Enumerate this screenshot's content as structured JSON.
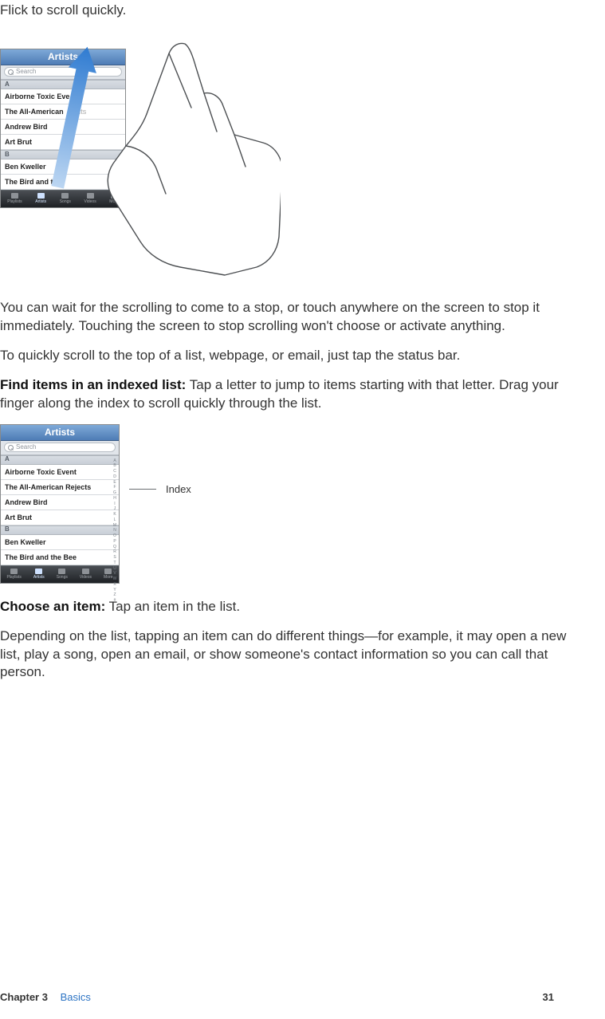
{
  "intro": "Flick to scroll quickly.",
  "para_after_fig1": "You can wait for the scrolling to come to a stop, or touch anywhere on the screen to stop it immediately. Touching the screen to stop scrolling won't choose or activate anything.",
  "para_scroll_top": "To quickly scroll to the top of a list, webpage, or email, just tap the status bar.",
  "find_label": "Find items in an indexed list:",
  "find_body": "Tap a letter to jump to items starting with that letter. Drag your finger along the index to scroll quickly through the list.",
  "index_callout": "Index",
  "choose_label": "Choose an item:",
  "choose_body": "Tap an item in the list.",
  "para_depending": "Depending on the list, tapping an item can do different things—for example, it may open a new list, play a song, open an email, or show someone's contact information so you can call that person.",
  "footer": {
    "chapter": "Chapter 3",
    "title": "Basics",
    "page": "31"
  },
  "ipod": {
    "title": "Artists",
    "search_placeholder": "Search",
    "section_a": "A",
    "section_b": "B",
    "rows_a": [
      "Airborne Toxic Event",
      "The All-American Rejects",
      "Andrew Bird",
      "Art Brut"
    ],
    "rows_b": [
      "Ben Kweller",
      "The Bird and the Bee"
    ],
    "rows_a_trunc": [
      "Airborne Toxic Eve",
      "The All-American",
      "Andrew Bird",
      "Art Brut"
    ],
    "rows_b_trunc": [
      "Ben Kweller",
      "The Bird and the"
    ],
    "tabs": [
      "Playlists",
      "Artists",
      "Songs",
      "Videos",
      "More"
    ],
    "index_letters": [
      "A",
      "B",
      "C",
      "D",
      "E",
      "F",
      "G",
      "H",
      "I",
      "J",
      "K",
      "L",
      "M",
      "N",
      "O",
      "P",
      "Q",
      "R",
      "S",
      "T",
      "U",
      "V",
      "W",
      "X",
      "Y",
      "Z",
      "#"
    ]
  }
}
